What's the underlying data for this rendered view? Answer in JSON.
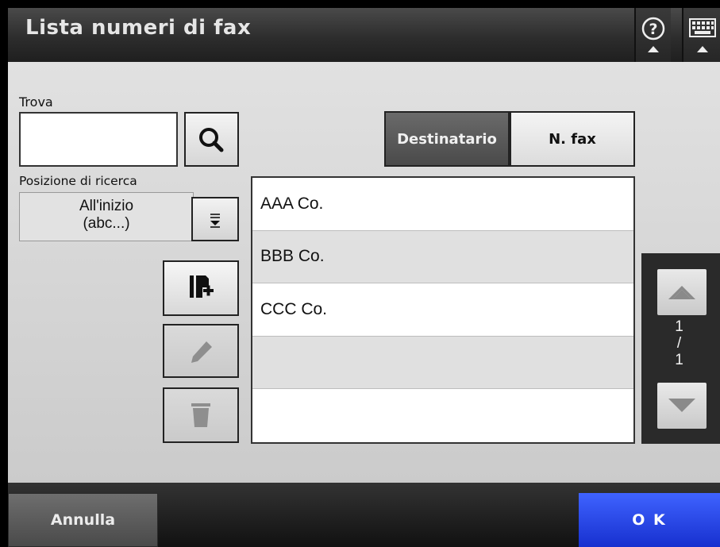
{
  "header": {
    "title": "Lista numeri di fax",
    "help_icon": "help-question-icon",
    "keyboard_icon": "keyboard-icon"
  },
  "search": {
    "label": "Trova",
    "value": "",
    "icon": "search-icon"
  },
  "search_position": {
    "label": "Posizione di ricerca",
    "value_line1": "All'inizio",
    "value_line2": "(abc...)",
    "dropdown_icon": "dropdown-list-icon"
  },
  "actions": {
    "add_icon": "add-entry-icon",
    "edit_icon": "pencil-icon",
    "delete_icon": "trash-icon"
  },
  "tabs": [
    {
      "label": "Destinatario",
      "selected": true
    },
    {
      "label": "N. fax",
      "selected": false
    }
  ],
  "list": {
    "rows": [
      "AAA Co.",
      "BBB Co.",
      "CCC Co.",
      "",
      ""
    ]
  },
  "pagination": {
    "current": "1",
    "separator": "/",
    "total": "1"
  },
  "footer": {
    "cancel_label": "Annulla",
    "ok_label": "O K"
  },
  "colors": {
    "ok_button": "#2441e6",
    "header_bg": "#2d2d2d",
    "main_bg": "#d6d6d6"
  }
}
